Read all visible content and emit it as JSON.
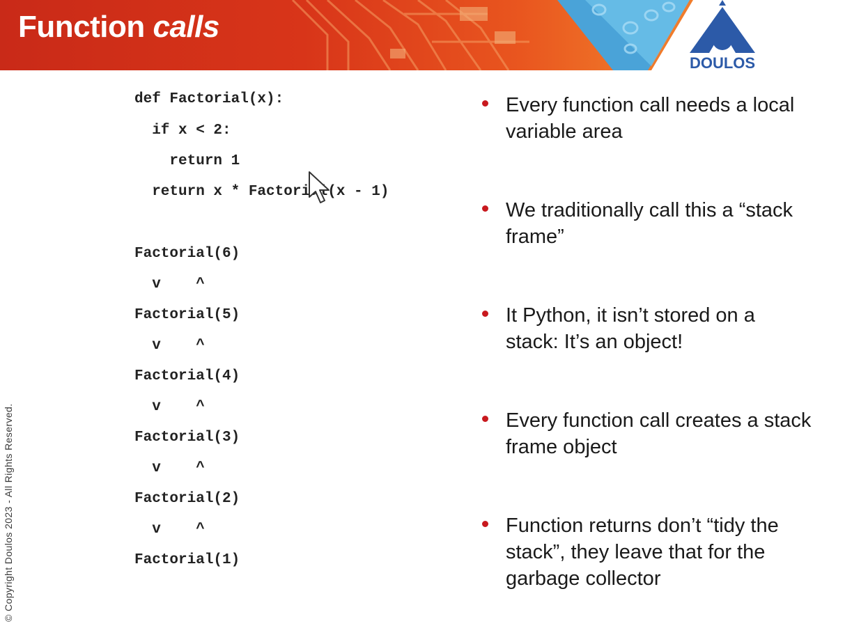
{
  "header": {
    "title_main": "Function ",
    "title_italic": "calls",
    "logo_text": "DOULOS"
  },
  "code": {
    "lines": [
      "def Factorial(x):",
      "  if x < 2:",
      "    return 1",
      "  return x * Factorial(x - 1)"
    ],
    "trace": [
      "Factorial(6)",
      "  v    ^",
      "Factorial(5)",
      "  v    ^",
      "Factorial(4)",
      "  v    ^",
      "Factorial(3)",
      "  v    ^",
      "Factorial(2)",
      "  v    ^",
      "Factorial(1)"
    ]
  },
  "bullets": [
    "Every function call needs a local variable area",
    "We traditionally call this a “stack frame”",
    "It Python, it isn’t stored on a stack: It’s an object!",
    "Every function call creates a stack frame object",
    "Function returns don’t “tidy the stack”, they leave that for the garbage collector"
  ],
  "footer": {
    "copyright": "© Copyright Doulos 2023 - All Rights Reserved."
  },
  "colors": {
    "banner_red": "#c92a18",
    "banner_orange": "#f07a2a",
    "bullet_red": "#c8191e",
    "logo_blue": "#2c5aa8"
  },
  "icons": [
    "mouse-pointer-icon",
    "doulos-logo-icon",
    "bullet-dot-icon"
  ]
}
